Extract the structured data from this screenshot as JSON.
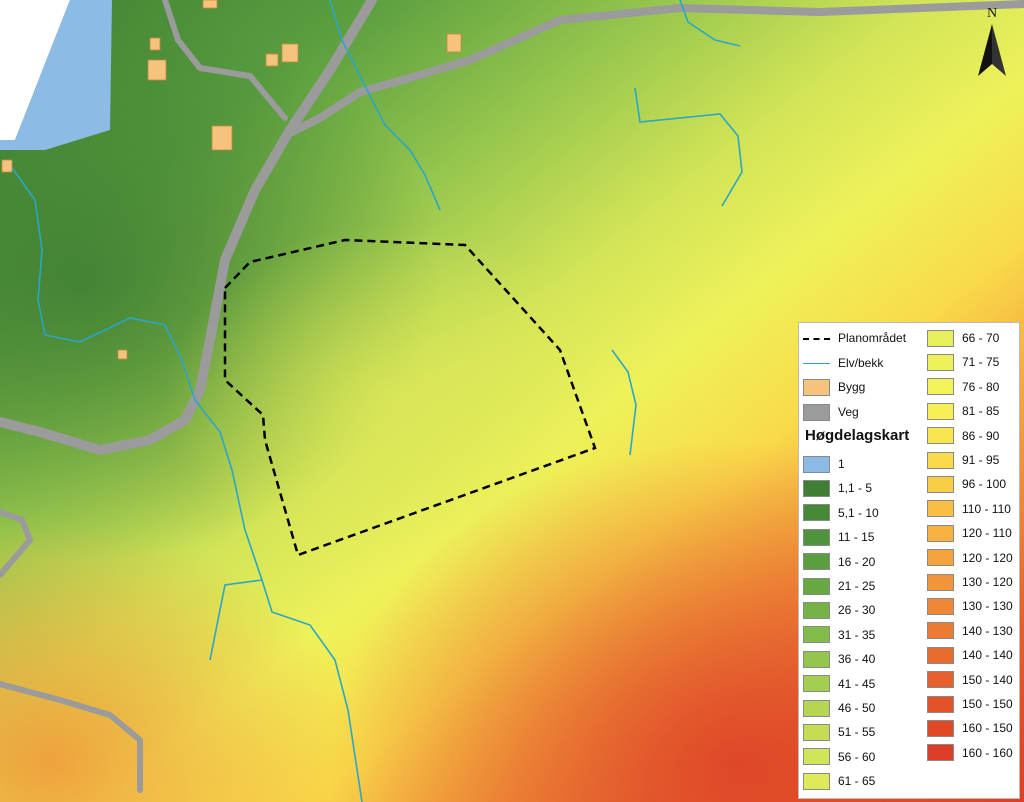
{
  "map": {
    "north_label": "N",
    "colors": {
      "water": "#8cbbe6",
      "road": "#9b9b9b",
      "building": "#f5c37e",
      "building_border": "#c08a3a",
      "stream": "#2aa6c8",
      "boundary": "#000000"
    }
  },
  "legend": {
    "title": "Høgdelagskart",
    "symbols": [
      {
        "label": "Planområdet",
        "kind": "dashed-line",
        "color": "#000000"
      },
      {
        "label": "Elv/bekk",
        "kind": "line",
        "color": "#2aa6c8"
      },
      {
        "label": "Bygg",
        "kind": "fill",
        "color": "#f5c37e"
      },
      {
        "label": "Veg",
        "kind": "fill",
        "color": "#9b9b9b"
      }
    ],
    "classes": [
      {
        "label": "1",
        "color": "#8cbbe6"
      },
      {
        "label": "1,1 - 5",
        "color": "#3f7f33"
      },
      {
        "label": "5,1 - 10",
        "color": "#468a38"
      },
      {
        "label": "11 - 15",
        "color": "#4f943c"
      },
      {
        "label": "16 - 20",
        "color": "#5a9e3f"
      },
      {
        "label": "21 - 25",
        "color": "#67a843"
      },
      {
        "label": "26 - 30",
        "color": "#75b247"
      },
      {
        "label": "31 - 35",
        "color": "#84bc4a"
      },
      {
        "label": "36 - 40",
        "color": "#94c54d"
      },
      {
        "label": "41 - 45",
        "color": "#a4ce4f"
      },
      {
        "label": "46 - 50",
        "color": "#b4d652"
      },
      {
        "label": "51 - 55",
        "color": "#c4dd54"
      },
      {
        "label": "56 - 60",
        "color": "#d2e457"
      },
      {
        "label": "61 - 65",
        "color": "#ddea59"
      },
      {
        "label": "66 - 70",
        "color": "#e7ef5a"
      },
      {
        "label": "71 - 75",
        "color": "#eef25a"
      },
      {
        "label": "76 - 80",
        "color": "#f4f45a"
      },
      {
        "label": "81 - 85",
        "color": "#f7ef55"
      },
      {
        "label": "86 - 90",
        "color": "#f9e64f"
      },
      {
        "label": "91 - 95",
        "color": "#f9da4a"
      },
      {
        "label": "96 - 100",
        "color": "#f9cd46"
      },
      {
        "label": "110 - 110",
        "color": "#f8bf43"
      },
      {
        "label": "120 - 110",
        "color": "#f6b140"
      },
      {
        "label": "120 - 120",
        "color": "#f4a33c"
      },
      {
        "label": "130 - 120",
        "color": "#f29539"
      },
      {
        "label": "130 - 130",
        "color": "#ef8735"
      },
      {
        "label": "140 - 130",
        "color": "#ec7a32"
      },
      {
        "label": "140 - 140",
        "color": "#e96c2f"
      },
      {
        "label": "150 - 140",
        "color": "#e65f2c"
      },
      {
        "label": "150 - 150",
        "color": "#e3532a"
      },
      {
        "label": "160 - 150",
        "color": "#e04828"
      },
      {
        "label": "160 - 160",
        "color": "#dc3e27"
      }
    ]
  }
}
